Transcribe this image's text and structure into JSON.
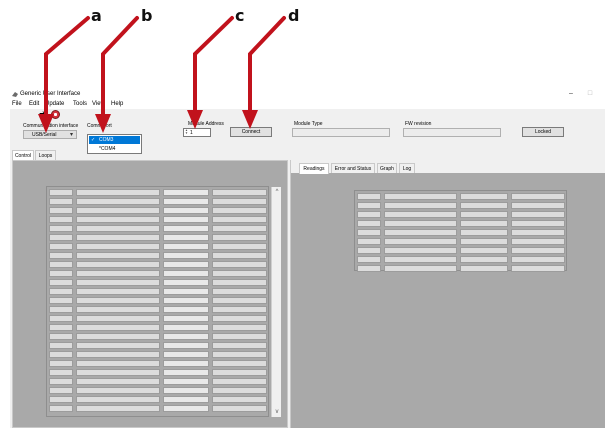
{
  "annotations": {
    "letters": [
      "a",
      "b",
      "c",
      "d"
    ]
  },
  "window": {
    "title": "Generic User Interface",
    "minimize_glyph": "–",
    "maximize_glyph": "□"
  },
  "menu": {
    "file": "File",
    "edit": "Edit",
    "update": "Update",
    "tools": "Tools",
    "view": "View",
    "help": "Help"
  },
  "toolbar": {
    "connect_icon": "arrow-right-icon",
    "stop_icon": "stop-icon"
  },
  "connection": {
    "interface_label": "Communication interface",
    "interface_value": "USB/Serial",
    "port_label": "Comm port",
    "port_options": [
      {
        "label": "COM3",
        "checked": true
      },
      {
        "label": "*COM4",
        "checked": false
      }
    ],
    "address_label": "Module Address",
    "address_value": "1",
    "connect_label": "Connect",
    "module_type_label": "Module Type",
    "fw_revision_label": "FW revision",
    "locked_label": "Locked"
  },
  "left_tabs": [
    "Control",
    "Loops"
  ],
  "right_tabs": [
    "Readings",
    "Error and Status",
    "Graph",
    "Log"
  ],
  "scrollbar": {
    "up_glyph": "^",
    "down_glyph": "v"
  }
}
